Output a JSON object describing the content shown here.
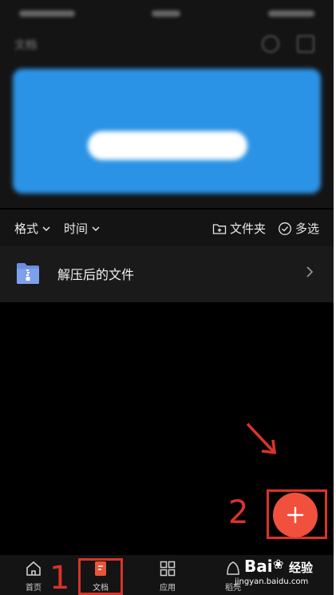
{
  "filter_bar": {
    "format_label": "格式",
    "time_label": "时间",
    "folder_label": "文件夹",
    "multiselect_label": "多选"
  },
  "files": [
    {
      "name": "解压后的文件"
    }
  ],
  "tabs": [
    {
      "label": "首页",
      "icon": "home-icon"
    },
    {
      "label": "文档",
      "icon": "document-icon"
    },
    {
      "label": "应用",
      "icon": "apps-grid-icon"
    },
    {
      "label": "稻壳",
      "icon": "shell-icon"
    }
  ],
  "annotations": {
    "step1": "1",
    "step2": "2"
  },
  "watermark": {
    "logo_text": "Bai",
    "logo_suffix": "经验",
    "url": "jingyan.baidu.com"
  },
  "colors": {
    "fab": "#f0503c",
    "annotation_red": "#d9332b",
    "active_tab_icon": "#e4573a",
    "banner": "#2b93e6"
  }
}
